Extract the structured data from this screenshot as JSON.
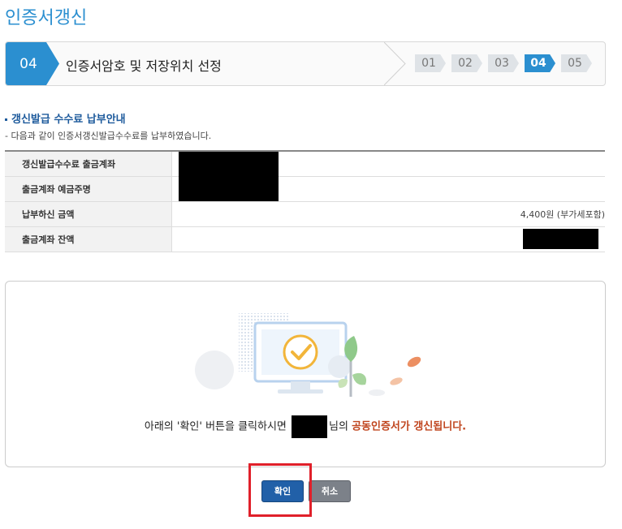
{
  "page": {
    "title": "인증서갱신"
  },
  "step_bar": {
    "current_number": "04",
    "current_title": "인증서암호 및 저장위치 선정",
    "steps": [
      "01",
      "02",
      "03",
      "04",
      "05"
    ],
    "active_step": "04"
  },
  "fee_section": {
    "heading": "갱신발급 수수료 납부안내",
    "description": "- 다음과 같이 인증서갱신발급수수료를 납부하였습니다.",
    "rows": [
      {
        "label": "갱신발급수수료 출금계좌",
        "value": ""
      },
      {
        "label": "출금계좌 예금주명",
        "value": ""
      },
      {
        "label": "납부하신 금액",
        "value": "4,400원 (부가세포함)"
      },
      {
        "label": "출금계좌 잔액",
        "value": ""
      }
    ]
  },
  "notice": {
    "prefix": "아래의 '확인' 버튼을 클릭하시면",
    "middle": "님의",
    "highlight": "공동인증서가 갱신됩니다."
  },
  "buttons": {
    "confirm": "확인",
    "cancel": "취소"
  },
  "colors": {
    "accent": "#2b8fd0",
    "highlight_text": "#c0451e",
    "annotation_box": "#e0202a"
  }
}
